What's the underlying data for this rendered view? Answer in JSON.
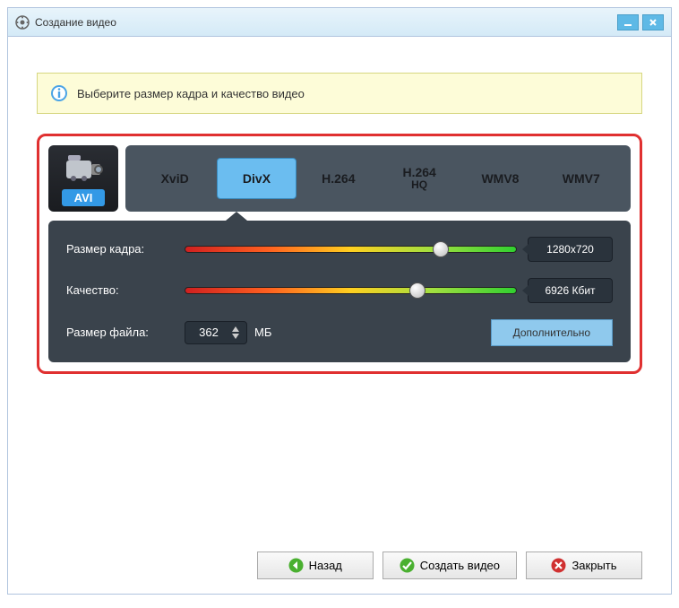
{
  "window": {
    "title": "Создание видео"
  },
  "info": {
    "text": "Выберите размер кадра и качество видео"
  },
  "format": {
    "label": "AVI"
  },
  "codecs": {
    "items": [
      "XviD",
      "DivX",
      "H.264",
      "H.264 HQ",
      "WMV8",
      "WMV7"
    ],
    "selected": "DivX"
  },
  "params": {
    "frame_size": {
      "label": "Размер кадра:",
      "value": "1280x720",
      "position": 77
    },
    "quality": {
      "label": "Качество:",
      "value": "6926 Кбит",
      "position": 70
    },
    "file_size": {
      "label": "Размер файла:",
      "value": "362",
      "unit": "МБ"
    },
    "advanced": "Дополнительно"
  },
  "footer": {
    "back": "Назад",
    "create": "Создать видео",
    "close": "Закрыть"
  }
}
